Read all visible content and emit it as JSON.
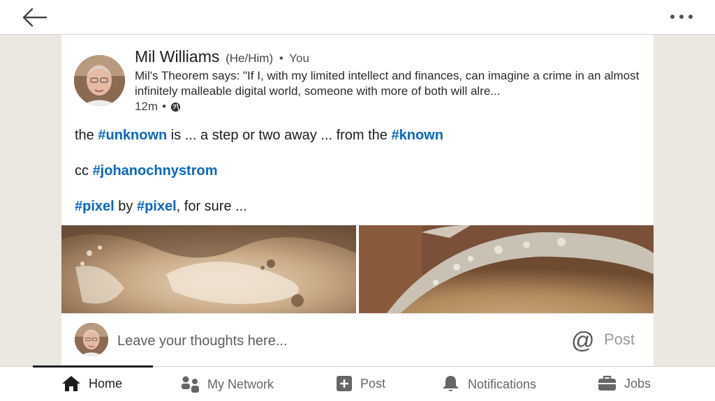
{
  "topbar": {
    "back_icon": "arrow-left-icon",
    "more_icon": "more-horizontal-icon"
  },
  "post": {
    "author_name": "Mil Williams",
    "author_pronouns": "(He/Him)",
    "author_sep": "•",
    "author_relation": "You",
    "headline": "Mil's Theorem says: \"If I, with my limited intellect and finances, can imagine a crime in an almost infinitely malleable digital world, someone with more of both will alre...",
    "time": "12m",
    "meta_sep": "•",
    "visibility_icon": "globe-icon",
    "line1": {
      "t1": "the ",
      "h1": "#unknown",
      "t2": " is ... a step or two away ... from the ",
      "h2": "#known"
    },
    "line2": {
      "t1": "cc ",
      "h1": "#johanochnystrom"
    },
    "line3": {
      "h1": "#pixel",
      "t1": " by ",
      "h2": "#pixel",
      "t2": ", for sure ..."
    }
  },
  "comment": {
    "placeholder": "Leave your thoughts here...",
    "mention_label": "@",
    "post_label": "Post"
  },
  "nav": {
    "items": [
      {
        "label": "Home",
        "icon": "home-icon",
        "active": true
      },
      {
        "label": "My Network",
        "icon": "network-icon",
        "active": false
      },
      {
        "label": "Post",
        "icon": "plus-square-icon",
        "active": false
      },
      {
        "label": "Notifications",
        "icon": "bell-icon",
        "active": false
      },
      {
        "label": "Jobs",
        "icon": "briefcase-icon",
        "active": false
      }
    ]
  },
  "colors": {
    "hashtag": "#0a66c2",
    "background": "#ebe7e1",
    "card": "#ffffff"
  }
}
